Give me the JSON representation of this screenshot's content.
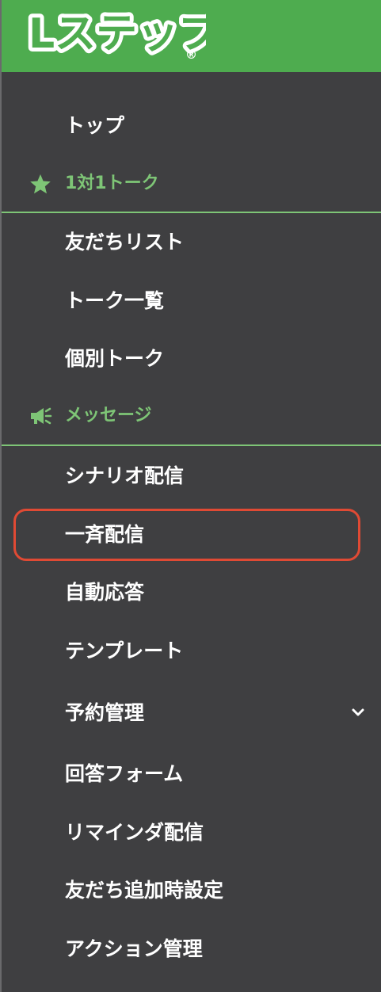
{
  "app": {
    "logo_text": "Lステップ",
    "logo_reg": "®",
    "brand_color": "#4eac4f",
    "accent_color": "#7ec576",
    "highlight_color": "#e04a34"
  },
  "menu": {
    "top": "トップ",
    "section_talk": {
      "label": "1対1トーク",
      "icon": "star-icon"
    },
    "friends_list": "友だちリスト",
    "talk_list": "トーク一覧",
    "individual_talk": "個別トーク",
    "section_message": {
      "label": "メッセージ",
      "icon": "megaphone-icon"
    },
    "scenario": "シナリオ配信",
    "broadcast": "一斉配信",
    "auto_reply": "自動応答",
    "template": "テンプレート",
    "reservation": "予約管理",
    "answer_form": "回答フォーム",
    "reminder": "リマインダ配信",
    "friend_add_settings": "友だち追加時設定",
    "action_manage": "アクション管理"
  }
}
